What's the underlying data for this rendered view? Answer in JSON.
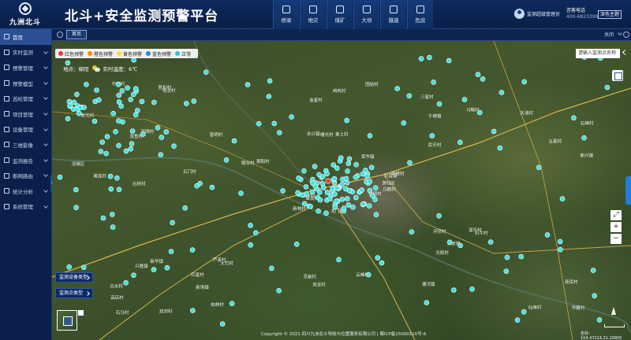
{
  "app": {
    "logo_text": "九洲北斗",
    "title": "北斗+安全监测预警平台"
  },
  "nav": [
    {
      "label": "桥梁",
      "icon": "bridge-icon"
    },
    {
      "label": "地灾",
      "icon": "landslide-icon"
    },
    {
      "label": "煤矿",
      "icon": "mine-icon"
    },
    {
      "label": "大坝",
      "icon": "dam-icon"
    },
    {
      "label": "隧道",
      "icon": "tunnel-icon"
    },
    {
      "label": "危房",
      "icon": "house-icon"
    }
  ],
  "user": {
    "name": "监测超级管理员",
    "contact_label": "咨客电话",
    "contact_phone": "400-6823399",
    "theme": "深色主题"
  },
  "sidebar": {
    "items": [
      {
        "label": "首页",
        "icon": "home-icon",
        "active": true,
        "has_children": false
      },
      {
        "label": "实时监测",
        "icon": "monitor-icon",
        "has_children": true
      },
      {
        "label": "预警管理",
        "icon": "alarm-icon",
        "has_children": true
      },
      {
        "label": "预警模型",
        "icon": "model-icon",
        "has_children": true
      },
      {
        "label": "巡检管理",
        "icon": "patrol-icon",
        "has_children": true
      },
      {
        "label": "项目管理",
        "icon": "project-icon",
        "has_children": true
      },
      {
        "label": "设备管理",
        "icon": "device-icon",
        "has_children": true
      },
      {
        "label": "三维影像",
        "icon": "3d-icon",
        "has_children": true
      },
      {
        "label": "监测报告",
        "icon": "report-icon",
        "has_children": true
      },
      {
        "label": "断网路由",
        "icon": "network-icon",
        "has_children": true
      },
      {
        "label": "统计分析",
        "icon": "stats-icon",
        "has_children": true
      },
      {
        "label": "系统管理",
        "icon": "settings-icon",
        "has_children": true
      }
    ]
  },
  "tabs": {
    "home": "首页",
    "close_label": "关闭"
  },
  "map": {
    "legend": [
      {
        "label": "红色预警",
        "color": "#e53935"
      },
      {
        "label": "橙色预警",
        "color": "#fb8c00"
      },
      {
        "label": "黄色预警",
        "color": "#fdd835"
      },
      {
        "label": "蓝色预警",
        "color": "#1e88e5"
      },
      {
        "label": "正常",
        "color": "#26c6da"
      }
    ],
    "weather": {
      "location": "地点：绵阳",
      "condition_icon": "partly-cloudy-icon",
      "temperature": "实时温度：6℃"
    },
    "search_placeholder": "请输入监测点名称",
    "device_type_button": "监测设备类型",
    "monitor_type_button": "监测点类型",
    "copyright": "Copyright © 2021 四川九洲北斗导航与位置服务有限公司 | 蜀ICP备15000110号-6",
    "coordinates": "坐标：104.47214,31.29800",
    "marker_color": "#3fe0e0",
    "place_labels": [
      "龙门镇",
      "双鱼村",
      "雄关村",
      "白水村",
      "安昌镇",
      "大竹村",
      "三星村",
      "黄土村",
      "千佛镇",
      "桃园村",
      "青龙村",
      "华藏村",
      "石桥村",
      "石碑村",
      "新林村",
      "民乐村",
      "双河村",
      "永兴镇",
      "荣华镇",
      "新华镇",
      "朝阳村",
      "高店村",
      "新场镇",
      "曙光村",
      "桥楼村",
      "石牛村",
      "双碑村",
      "金星村",
      "黄连村",
      "河坝村",
      "新兴镇",
      "安州区",
      "灵泉村",
      "桂花村",
      "普明村",
      "马鞍村",
      "芦溪村",
      "仙海村",
      "新民村",
      "富乐村",
      "团结村",
      "联合村",
      "石门村",
      "光辉村",
      "柏林村",
      "涪城区",
      "游仙区",
      "石马村",
      "双龙村",
      "白鹤村",
      "兴隆镇",
      "五星村",
      "新光村",
      "东宣镇",
      "塘汛镇",
      "红星村",
      "胜利村",
      "中和村",
      "云峰村",
      "天池村",
      "鸡鸣村"
    ]
  }
}
